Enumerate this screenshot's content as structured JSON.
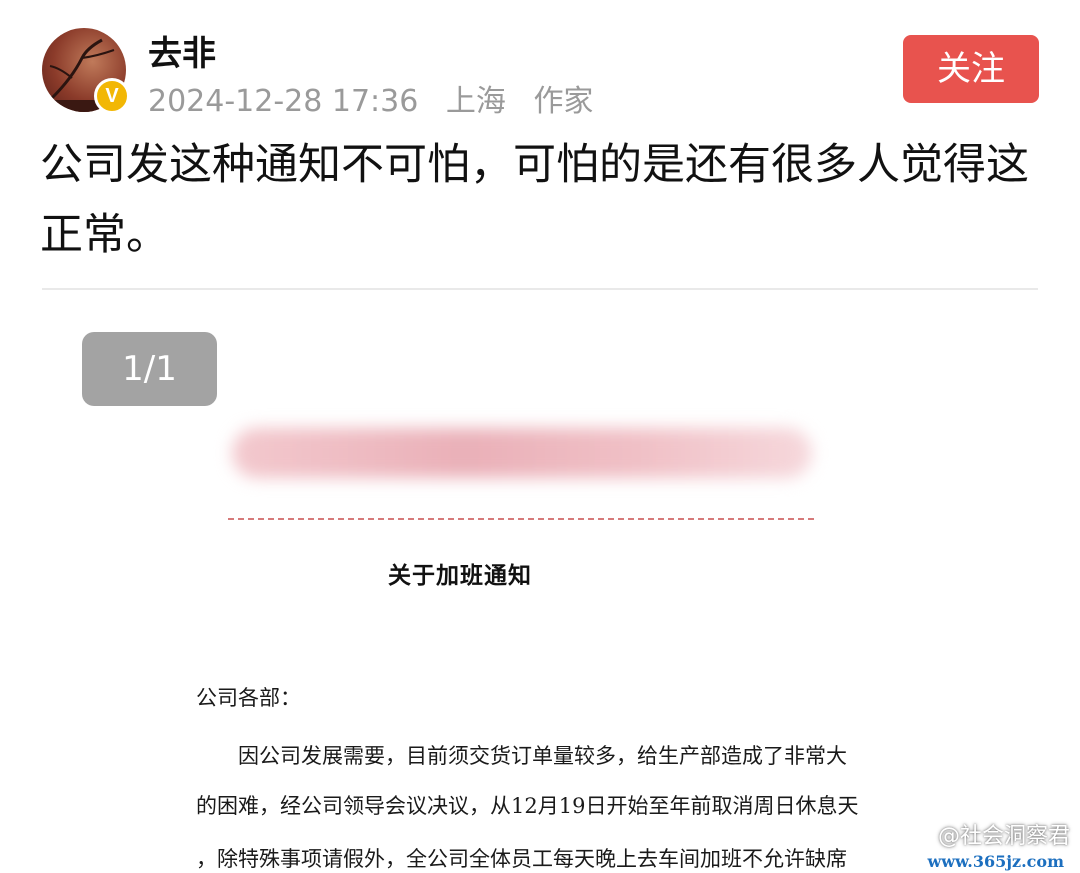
{
  "header": {
    "username": "去非",
    "timestamp": "2024-12-28 17:36",
    "location": "上海",
    "role": "作家",
    "verified_badge": "V",
    "follow_label": "关注",
    "follow_color": "#e8534e"
  },
  "post": {
    "text": "公司发这种通知不可怕，可怕的是还有很多人觉得这正常。"
  },
  "viewer": {
    "page_counter": "1/1"
  },
  "document": {
    "title": "关于加班通知",
    "salutation": "公司各部：",
    "line1": "因公司发展需要，目前须交货订单量较多，给生产部造成了非常大",
    "line2": "的困难，经公司领导会议决议，从12月19日开始至年前取消周日休息天",
    "line3": "，除特殊事项请假外，全公司全体员工每天晚上去车间加班不允许缺席"
  },
  "watermark": {
    "name": "@社会洞察君",
    "url": "www.365jz.com"
  }
}
